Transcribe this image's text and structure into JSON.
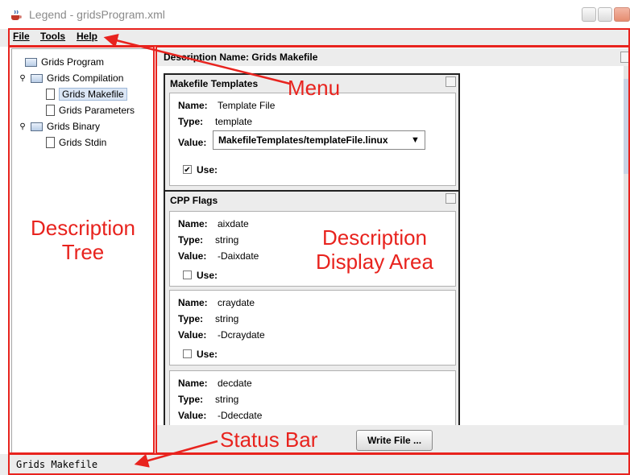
{
  "window": {
    "title": "Legend - gridsProgram.xml"
  },
  "menu": {
    "file": "File",
    "tools": "Tools",
    "help": "Help"
  },
  "tree": {
    "items": [
      {
        "label": "Grids Program",
        "icon": "folder-icon"
      },
      {
        "label": "Grids Compilation",
        "icon": "folder-icon",
        "expanded": true
      },
      {
        "label": "Grids Makefile",
        "icon": "file-icon",
        "selected": true
      },
      {
        "label": "Grids Parameters",
        "icon": "file-icon"
      },
      {
        "label": "Grids Binary",
        "icon": "folder-icon",
        "expanded": true
      },
      {
        "label": "Grids Stdin",
        "icon": "file-icon"
      }
    ]
  },
  "display": {
    "header": "Description Name: Grids Makefile",
    "groups": [
      {
        "title": "Makefile Templates",
        "items": [
          {
            "name_label": "Name:",
            "name": "Template File",
            "type_label": "Type:",
            "type": "template",
            "value_label": "Value:",
            "value": "MakefileTemplates/templateFile.linux",
            "use_label": "Use:",
            "use_checked": true
          }
        ]
      },
      {
        "title": "CPP Flags",
        "items": [
          {
            "name_label": "Name:",
            "name": "aixdate",
            "type_label": "Type:",
            "type": "string",
            "value_label": "Value:",
            "value": "-Daixdate",
            "use_label": "Use:",
            "use_checked": false
          },
          {
            "name_label": "Name:",
            "name": "craydate",
            "type_label": "Type:",
            "type": "string",
            "value_label": "Value:",
            "value": "-Dcraydate",
            "use_label": "Use:",
            "use_checked": false
          },
          {
            "name_label": "Name:",
            "name": "decdate",
            "type_label": "Type:",
            "type": "string",
            "value_label": "Value:",
            "value": "-Ddecdate"
          }
        ]
      }
    ]
  },
  "bottom": {
    "write_file": "Write File ..."
  },
  "status": {
    "text": "Grids Makefile"
  },
  "annotations": {
    "menu": "Menu",
    "tree_line1": "Description",
    "tree_line2": "Tree",
    "display_line1": "Description",
    "display_line2": "Display Area",
    "status": "Status Bar"
  },
  "colors": {
    "annotation": "#e8231e",
    "selection": "#dbe6f5"
  }
}
